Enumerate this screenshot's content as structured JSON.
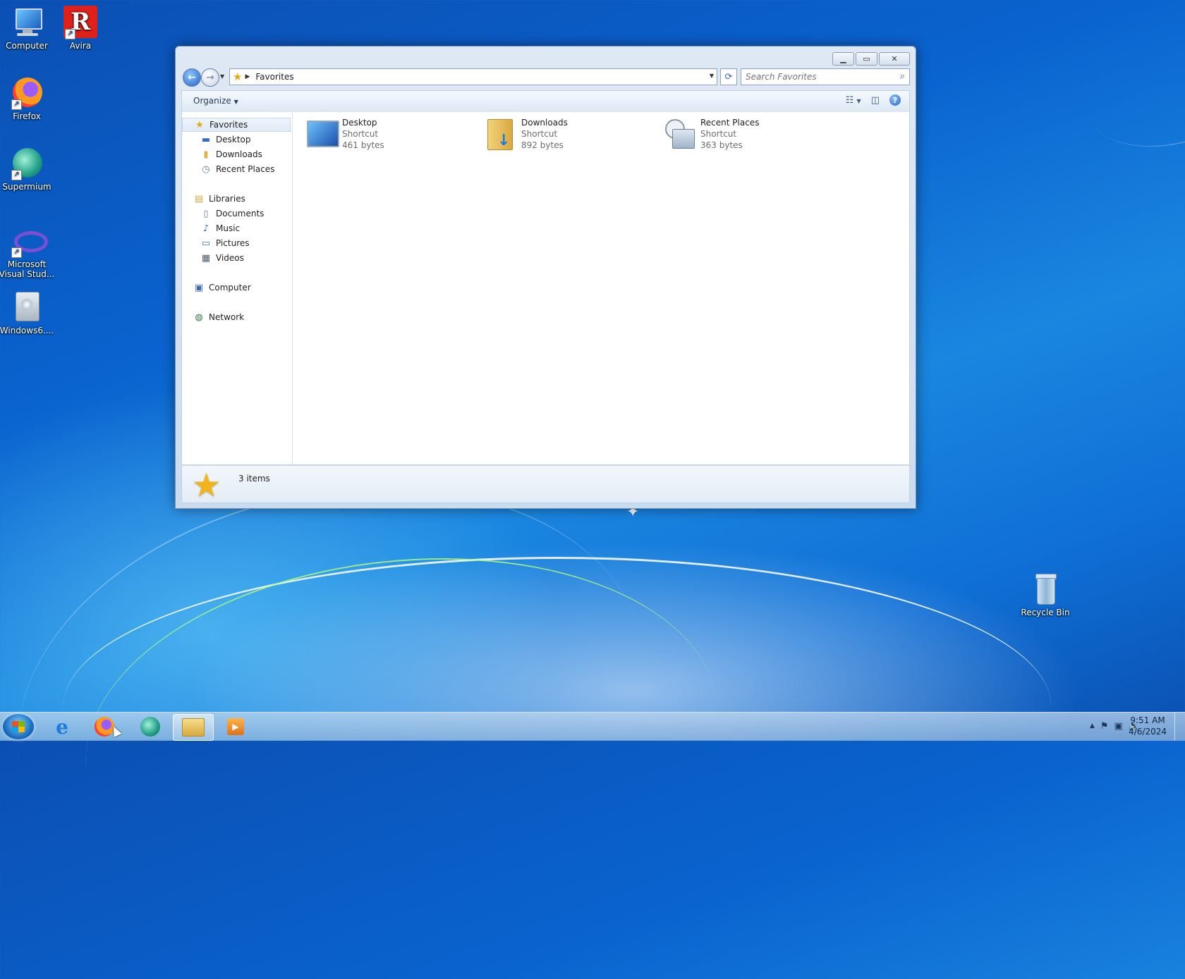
{
  "desktop": {
    "icons": [
      {
        "label": "Computer",
        "icon": "computer-icon"
      },
      {
        "label": "Avira",
        "icon": "avira-icon"
      },
      {
        "label": "Firefox",
        "icon": "firefox-icon"
      },
      {
        "label": "Supermium",
        "icon": "supermium-icon"
      },
      {
        "label": "Microsoft Visual Stud...",
        "icon": "visual-studio-icon"
      },
      {
        "label": "Windows6....",
        "icon": "installer-icon"
      },
      {
        "label": "Recycle Bin",
        "icon": "recycle-bin-icon"
      }
    ]
  },
  "explorer": {
    "address": {
      "location": "Favorites"
    },
    "search": {
      "placeholder": "Search Favorites"
    },
    "toolbar": {
      "organize": "Organize"
    },
    "nav": {
      "favorites": "Favorites",
      "favorites_items": [
        "Desktop",
        "Downloads",
        "Recent Places"
      ],
      "libraries": "Libraries",
      "libraries_items": [
        "Documents",
        "Music",
        "Pictures",
        "Videos"
      ],
      "computer": "Computer",
      "network": "Network"
    },
    "items": [
      {
        "name": "Desktop",
        "type": "Shortcut",
        "size": "461 bytes"
      },
      {
        "name": "Downloads",
        "type": "Shortcut",
        "size": "892 bytes"
      },
      {
        "name": "Recent Places",
        "type": "Shortcut",
        "size": "363 bytes"
      }
    ],
    "details": {
      "count": "3 items"
    }
  },
  "taskbar": {
    "clock": {
      "time": "9:51 AM",
      "date": "4/6/2024"
    }
  },
  "colors": {
    "accent": "#2463c4",
    "star": "#f0b41c"
  }
}
